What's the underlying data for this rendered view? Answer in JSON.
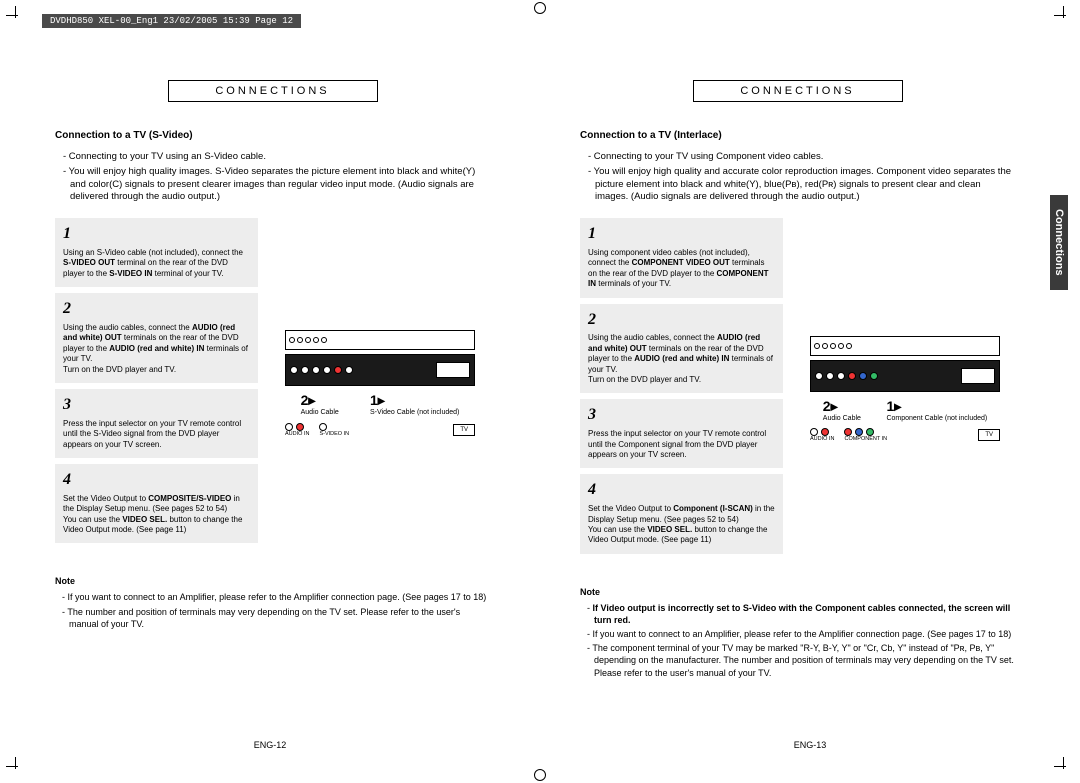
{
  "header_strip": "DVDHD850 XEL-00_Eng1  23/02/2005  15:39  Page 12",
  "side_tab": "Connections",
  "left": {
    "section_header": "CONNECTIONS",
    "subheading": "Connection to a TV (S-Video)",
    "intro": [
      "- Connecting to your TV using an S-Video cable.",
      "- You will enjoy high quality images. S-Video separates the picture element into black and white(Y) and color(C) signals to present clearer images than regular video input mode. (Audio signals are delivered through the audio output.)"
    ],
    "steps": [
      {
        "num": "1",
        "text": "Using an S-Video cable (not included), connect the <b>S-VIDEO OUT</b> terminal on the rear of the DVD player to the <b>S-VIDEO IN</b> terminal of your TV."
      },
      {
        "num": "2",
        "text": "Using the audio cables, connect the <b>AUDIO (red and white) OUT</b> terminals on the rear of the DVD player to the <b>AUDIO (red and white) IN</b> terminals of your TV.<br>Turn on the DVD player and TV."
      },
      {
        "num": "3",
        "text": "Press the input selector on your TV remote control until the S-Video signal from the DVD player appears on your TV screen."
      },
      {
        "num": "4",
        "text": "Set the Video Output to <b>COMPOSITE/S-VIDEO</b> in the Display Setup menu. (See pages 52 to 54)<br>You can use the <b>VIDEO SEL.</b> button to change the Video Output mode. (See page 11)"
      }
    ],
    "diagram": {
      "arrow2_label": "Audio Cable",
      "arrow1_label": "S-Video Cable (not included)",
      "tv_label": "TV",
      "audio_in": "AUDIO IN",
      "svideo_in": "S-VIDEO IN"
    },
    "note_title": "Note",
    "notes": [
      "- If you want to connect to an Amplifier, please refer to the Amplifier connection page. (See pages 17 to 18)",
      "- The number and position of terminals may very depending on the TV set. Please refer to the user's manual of your TV."
    ],
    "page_num": "ENG-12"
  },
  "right": {
    "section_header": "CONNECTIONS",
    "subheading": "Connection to a TV (Interlace)",
    "intro": [
      "- Connecting to your TV using Component video cables.",
      "- You will enjoy high quality and accurate color reproduction images. Component video separates the picture element into black and white(Y), blue(Pʙ), red(Pʀ) signals to present clear and clean images. (Audio signals are delivered through the audio output.)"
    ],
    "steps": [
      {
        "num": "1",
        "text": "Using component video cables (not included), connect the <b>COMPONENT VIDEO OUT</b> terminals on the rear of the DVD player to the <b>COMPONENT IN</b> terminals of your TV."
      },
      {
        "num": "2",
        "text": "Using the audio cables, connect the <b>AUDIO (red and white) OUT</b> terminals on the rear of the DVD player to the <b>AUDIO (red and white) IN</b> terminals of your TV.<br>Turn on the DVD player and TV."
      },
      {
        "num": "3",
        "text": "Press the input selector on your TV remote control until the Component signal from the DVD player appears on your TV screen."
      },
      {
        "num": "4",
        "text": "Set the Video Output to <b>Component (I-SCAN)</b> in the Display Setup menu. (See pages 52 to 54)<br>You can use the <b>VIDEO SEL.</b> button to change the Video Output mode. (See page 11)"
      }
    ],
    "diagram": {
      "arrow2_label": "Audio Cable",
      "arrow1_label": "Component Cable (not included)",
      "tv_label": "TV",
      "audio_in": "AUDIO IN",
      "component_in": "COMPONENT IN"
    },
    "note_title": "Note",
    "notes": [
      "- <b>If Video output is incorrectly set to S-Video with the Component cables connected, the screen will turn red.</b>",
      "- If you want to connect to an Amplifier, please refer to the Amplifier connection page. (See pages 17 to 18)",
      "- The component terminal of your TV may be marked \"R-Y, B-Y, Y\" or \"Cr, Cb, Y\" instead of \"Pʀ, Pʙ, Y\" depending on the manufacturer. The number and position of terminals may very depending on the TV set. Please refer to the user's manual of your TV."
    ],
    "page_num": "ENG-13"
  }
}
